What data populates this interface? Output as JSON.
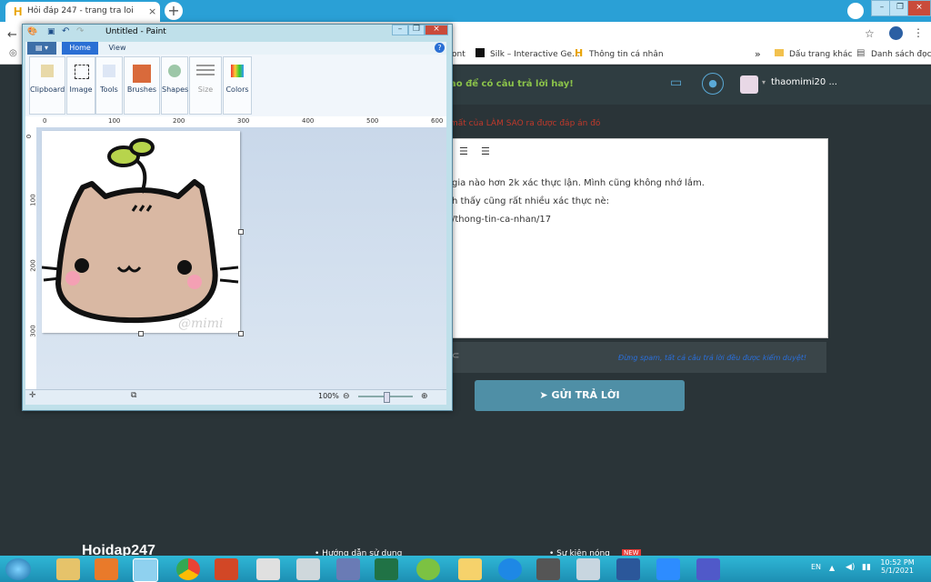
{
  "browser": {
    "tab_title": "Hỏi đáp 247 - trang tra loi",
    "tab_close": "×",
    "new_tab": "+",
    "bookmarks": [
      "ont",
      "Silk – Interactive Ge...",
      "Thông tin cá nhân",
      "»",
      "Dấu trang khác",
      "Danh sách đọc"
    ]
  },
  "page": {
    "header_promo": "ao để có câu trả lời hay!",
    "username": "thaomimi20 ...",
    "red_note": "mất của LÀM SAO ra được đáp án đó",
    "editor_lines": [
      "gia nào hơn 2k xác thực lận. Mình cũng không nhớ lắm.",
      "h thấy cũng rất nhiều xác thực nè:",
      "/thong-tin-ca-nhan/17"
    ],
    "spam_note": "Đừng spam, tất cả câu trả lời đều được kiểm duyệt!",
    "send_button": "GỬI TRẢ LỜI",
    "footer_logo": "Hoidap247",
    "footer_links": [
      "Hướng dẫn sử dụng",
      "Sự kiện nóng"
    ],
    "new_badge": "NEW"
  },
  "paint": {
    "title": "Untitled - Paint",
    "tabs": [
      "Home",
      "View"
    ],
    "groups": [
      "Clipboard",
      "Image",
      "Tools",
      "Brushes",
      "Shapes",
      "Size",
      "Colors"
    ],
    "ruler_h": [
      "0",
      "100",
      "200",
      "300",
      "400",
      "500",
      "600"
    ],
    "ruler_v": [
      "0",
      "100",
      "200",
      "300"
    ],
    "watermark": "@mimi",
    "zoom": "100%"
  },
  "taskbar": {
    "lang": "EN",
    "time": "10:52 PM",
    "date": "5/1/2021"
  }
}
